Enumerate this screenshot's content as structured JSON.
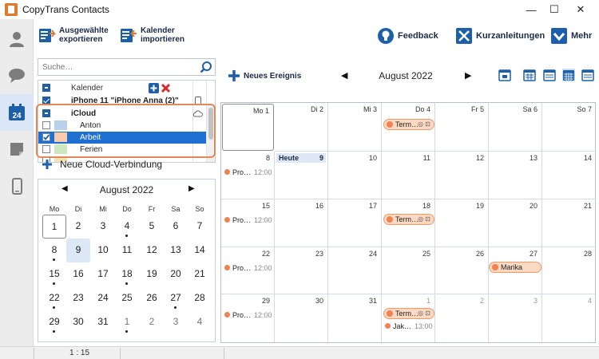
{
  "window": {
    "title": "CopyTrans Contacts",
    "minimize": "—",
    "maximize": "☐",
    "close": "✕"
  },
  "sidebar": {
    "items": [
      {
        "name": "contacts",
        "icon": "person-icon"
      },
      {
        "name": "messages",
        "icon": "chat-bubble-icon"
      },
      {
        "name": "calendar",
        "icon": "calendar-icon",
        "badge": "24",
        "active": true
      },
      {
        "name": "notes",
        "icon": "note-icon"
      },
      {
        "name": "devices",
        "icon": "phone-icon"
      }
    ]
  },
  "toolbar": {
    "export_label_1": "Ausgewählte",
    "export_label_2": "exportieren",
    "import_label_1": "Kalender",
    "import_label_2": "importieren",
    "feedback_label": "Feedback",
    "guides_label": "Kurzanleitungen",
    "more_label": "Mehr"
  },
  "search": {
    "placeholder": "Suche…"
  },
  "calendar_tree": {
    "header_label": "Kalender",
    "device_label": "iPhone 11 \"iPhone Anna (2)\"",
    "cloud_label": "iCloud",
    "calendars": [
      {
        "label": "Anton",
        "color": "#b9d0ea",
        "checked": false
      },
      {
        "label": "Arbeit",
        "color": "#f7c9ad",
        "checked": true,
        "selected": true
      },
      {
        "label": "Ferien",
        "color": "#cde8c0",
        "checked": false
      }
    ]
  },
  "new_cloud": {
    "label": "Neue Cloud-Verbindung"
  },
  "mini_calendar": {
    "month": "August 2022",
    "weekdays": [
      "Mo",
      "Di",
      "Mi",
      "Do",
      "Fr",
      "Sa",
      "So"
    ],
    "weeks": [
      [
        "1",
        "2",
        "3",
        "4",
        "5",
        "6",
        "7"
      ],
      [
        "8",
        "9",
        "10",
        "11",
        "12",
        "13",
        "14"
      ],
      [
        "15",
        "16",
        "17",
        "18",
        "19",
        "20",
        "21"
      ],
      [
        "22",
        "23",
        "24",
        "25",
        "26",
        "27",
        "28"
      ],
      [
        "29",
        "30",
        "31",
        "1",
        "2",
        "3",
        "4"
      ]
    ]
  },
  "main_calendar": {
    "new_event_label": "Neues Ereignis",
    "month": "August 2022",
    "today_label": "Heute",
    "header_days": [
      "Mo 1",
      "Di 2",
      "Mi 3",
      "Do 4",
      "Fr 5",
      "Sa 6",
      "So 7"
    ],
    "weeks": [
      [
        "8",
        "9",
        "10",
        "11",
        "12",
        "13",
        "14"
      ],
      [
        "15",
        "16",
        "17",
        "18",
        "19",
        "20",
        "21"
      ],
      [
        "22",
        "23",
        "24",
        "25",
        "26",
        "27",
        "28"
      ],
      [
        "29",
        "30",
        "31",
        "1",
        "2",
        "3",
        "4"
      ]
    ],
    "events": {
      "term_label": "Term…",
      "term_icons": "◎ ⊡",
      "pro_label": "Pro…",
      "pro_time": "12:00",
      "marika_label": "Marika",
      "jak_label": "Jak…",
      "jak_time": "13:00"
    }
  },
  "status": {
    "text": "1 : 15"
  },
  "colors": {
    "accent": "#1e5fa9",
    "event_orange": "#ef8250",
    "event_fill": "#fcd9c3",
    "highlight": "#e28a57"
  }
}
